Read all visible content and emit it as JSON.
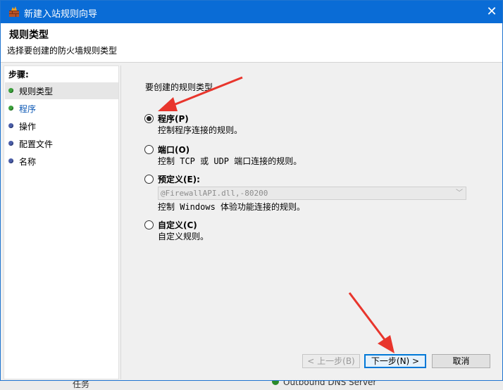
{
  "window": {
    "title": "新建入站规则向导",
    "close_symbol": "✕"
  },
  "header": {
    "title": "规则类型",
    "subtitle": "选择要创建的防火墙规则类型"
  },
  "steps": {
    "label": "步骤:",
    "items": [
      {
        "label": "规则类型"
      },
      {
        "label": "程序"
      },
      {
        "label": "操作"
      },
      {
        "label": "配置文件"
      },
      {
        "label": "名称"
      }
    ]
  },
  "content": {
    "prompt": "要创建的规则类型",
    "options": [
      {
        "label": "程序(P)",
        "desc": "控制程序连接的规则。",
        "checked": true
      },
      {
        "label": "端口(O)",
        "desc": "控制 TCP 或 UDP 端口连接的规则。",
        "checked": false
      },
      {
        "label": "预定义(E):",
        "desc": "控制 Windows 体验功能连接的规则。",
        "checked": false
      },
      {
        "label": "自定义(C)",
        "desc": "自定义规则。",
        "checked": false
      }
    ],
    "predefined_value": "@FirewallAPI.dll,-80200"
  },
  "buttons": {
    "back": "< 上一步(B)",
    "next": "下一步(N) >",
    "cancel": "取消"
  },
  "background": {
    "left_text": "任务",
    "bottom_text": "Outbound DNS Server"
  },
  "icons": {
    "app": "firewall-wizard-icon",
    "close": "close-icon",
    "chevron": "chevron-down-icon"
  }
}
